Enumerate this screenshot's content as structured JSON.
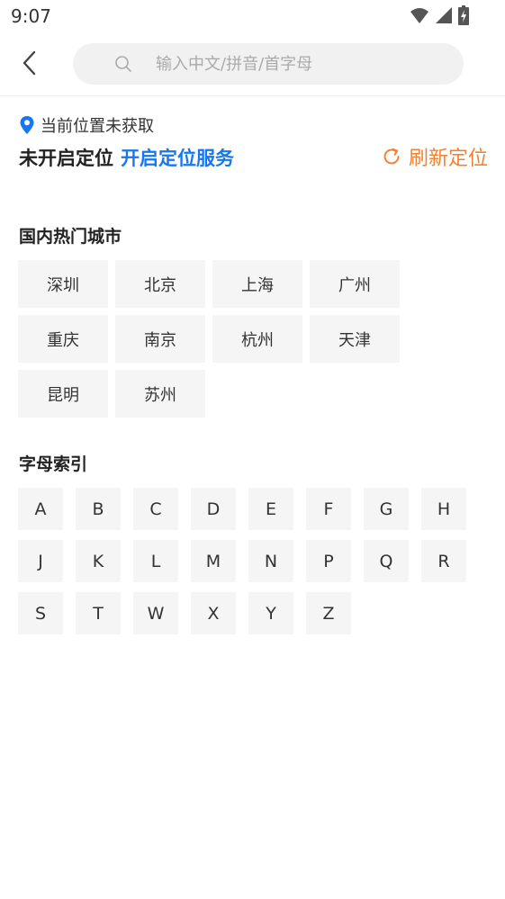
{
  "status_bar": {
    "time": "9:07"
  },
  "search": {
    "placeholder": "输入中文/拼音/首字母"
  },
  "location": {
    "current_label": "当前位置未获取",
    "status": "未开启定位",
    "enable_link": "开启定位服务",
    "refresh_label": "刷新定位"
  },
  "hot_cities": {
    "title": "国内热门城市",
    "items": [
      "深圳",
      "北京",
      "上海",
      "广州",
      "重庆",
      "南京",
      "杭州",
      "天津",
      "昆明",
      "苏州"
    ]
  },
  "letter_index": {
    "title": "字母索引",
    "items": [
      "A",
      "B",
      "C",
      "D",
      "E",
      "F",
      "G",
      "H",
      "J",
      "K",
      "L",
      "M",
      "N",
      "P",
      "Q",
      "R",
      "S",
      "T",
      "W",
      "X",
      "Y",
      "Z"
    ]
  },
  "colors": {
    "link_blue": "#1677f0",
    "refresh_orange": "#f08233",
    "chip_bg": "#f5f5f5"
  }
}
